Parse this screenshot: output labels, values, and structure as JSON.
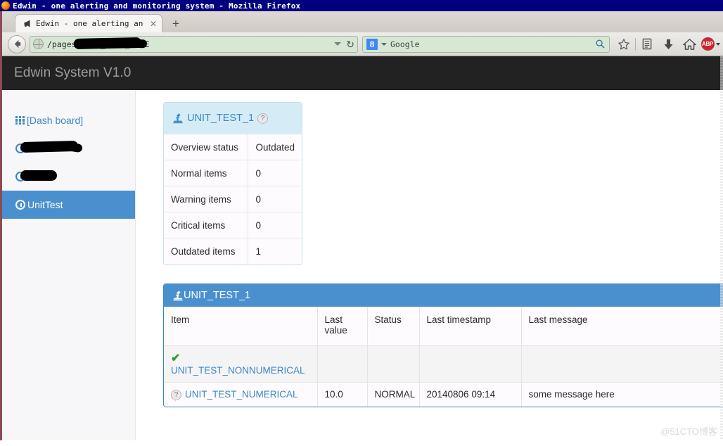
{
  "window": {
    "title": "Edwin - one alerting and monitoring system - Mozilla Firefox",
    "app_icon": "firefox-icon"
  },
  "browser": {
    "tab": {
      "label": "Edwin - one alerting an⋯",
      "icon": "megaphone-icon",
      "close_label": "✕"
    },
    "new_tab_label": "+",
    "back_label": "◀",
    "url": "/pages/UNIT_TEST_PAGE",
    "url_redacted": true,
    "go_label": "↻",
    "search": {
      "engine_badge": "8",
      "value": "Google",
      "placeholder": "Google",
      "icon": "magnifier-icon"
    },
    "toolbar_icons": [
      {
        "name": "bookmark-star-icon",
        "glyph": "☆"
      },
      {
        "name": "reader-list-icon",
        "glyph": "▤"
      },
      {
        "name": "downloads-icon",
        "glyph": "⬇"
      },
      {
        "name": "home-icon",
        "glyph": "⌂"
      },
      {
        "name": "adblock-plus-icon",
        "glyph": "ABP"
      }
    ]
  },
  "app": {
    "header_title": "Edwin System V1.0",
    "sidebar": {
      "items": [
        {
          "label": "[Dash board]",
          "icon": "grid-icon",
          "active": false,
          "redacted": false
        },
        {
          "label": "",
          "icon": "clock-icon",
          "active": false,
          "redacted": true
        },
        {
          "label": "",
          "icon": "clock-icon",
          "active": false,
          "redacted": true
        },
        {
          "label": "UnitTest",
          "icon": "clock-icon",
          "active": true,
          "redacted": false
        }
      ]
    },
    "summary_panel": {
      "title": "UNIT_TEST_1",
      "title_icon": "microscope-icon",
      "help_icon": "?",
      "rows": [
        {
          "label": "Overview status",
          "value": "Outdated"
        },
        {
          "label": "Normal items",
          "value": "0"
        },
        {
          "label": "Warning items",
          "value": "0"
        },
        {
          "label": "Critical items",
          "value": "0"
        },
        {
          "label": "Outdated items",
          "value": "1"
        }
      ]
    },
    "main_panel": {
      "title": "UNIT_TEST_1",
      "title_icon": "microscope-icon",
      "columns": [
        "Item",
        "Last value",
        "Status",
        "Last timestamp",
        "Last message"
      ],
      "rows": [
        {
          "status_icon": "green-check-icon",
          "item": "UNIT_TEST_NONNUMERICAL",
          "last_value": "",
          "status": "",
          "last_timestamp": "",
          "last_message": ""
        },
        {
          "status_icon": "question-bubble-icon",
          "item": "UNIT_TEST_NUMERICAL",
          "last_value": "10.0",
          "status": "NORMAL",
          "last_timestamp": "20140806 09:14",
          "last_message": "some message here"
        }
      ]
    },
    "watermark": "@51CTO博客"
  },
  "colors": {
    "titlebar": "#000080",
    "app_header_bg": "#222222",
    "accent_blue": "#4a90ce",
    "link_blue": "#3a87c8",
    "summary_header_bg": "#d5ecf7",
    "status_normal": "#2f7d32",
    "timestamp": "#c07818",
    "sidebar_bg": "#f7f7f9"
  }
}
